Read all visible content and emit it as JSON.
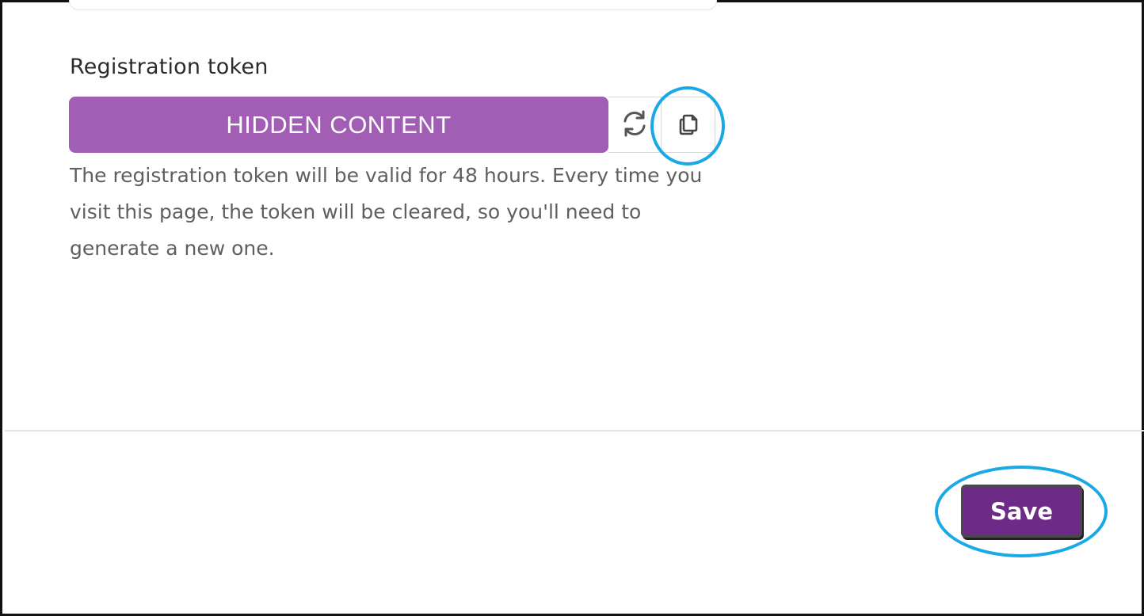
{
  "registration": {
    "label": "Registration token",
    "token_value": "HIDDEN CONTENT",
    "refresh_icon": "refresh-icon",
    "copy_icon": "copy-icon",
    "help_text": "The registration token will be valid for 48 hours. Every time you visit this page, the token will be cleared, so you'll need to generate a new one."
  },
  "footer": {
    "save_label": "Save"
  },
  "colors": {
    "token_background": "#a25db5",
    "save_background": "#6d2b87",
    "highlight": "#1aa9e6"
  }
}
